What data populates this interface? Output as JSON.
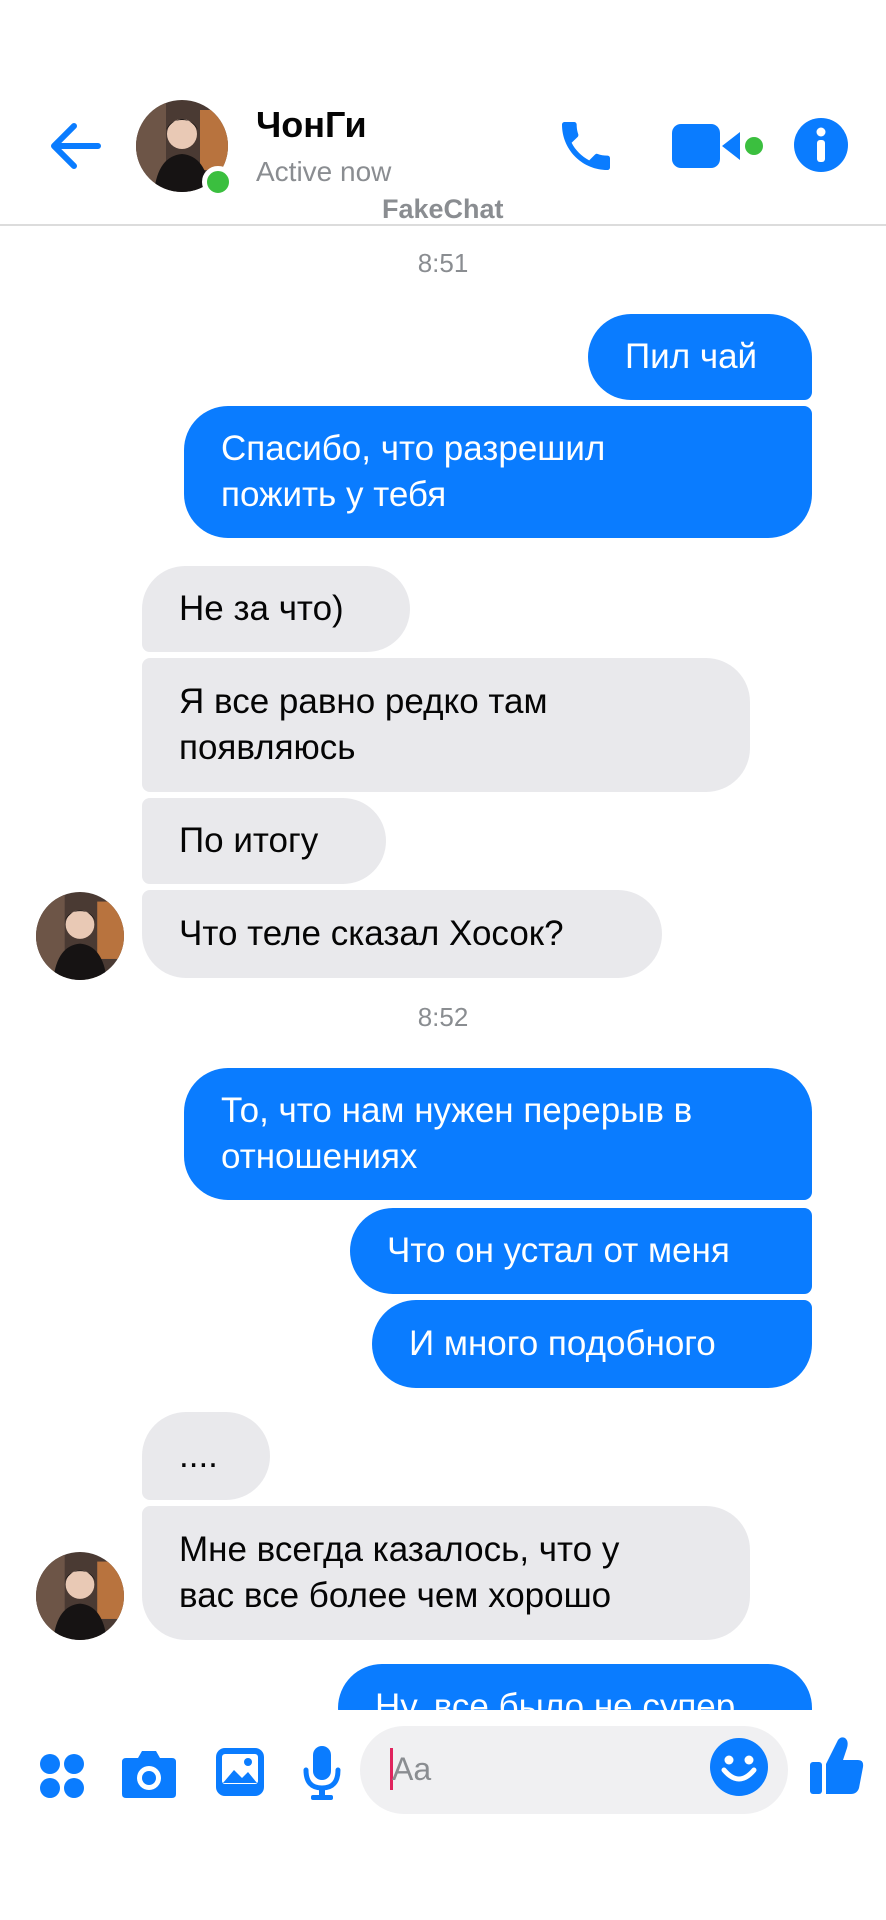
{
  "header": {
    "contact_name": "ЧонГи",
    "status": "Active now",
    "watermark": "FakeChat"
  },
  "messages": {
    "time_1": "8:51",
    "m1": "Пил чай",
    "m2_l1": "Спасибо, что разрешил",
    "m2_l2": "пожить у тебя",
    "m3": "Не за что)",
    "m4_l1": "Я все равно редко там",
    "m4_l2": "появляюсь",
    "m5": "По итогу",
    "m6": "Что теле сказал Хосок?",
    "time_2": "8:52",
    "m7_l1": "То, что нам нужен перерыв в",
    "m7_l2": "отношениях",
    "m8": "Что он устал от меня",
    "m9": "И много подобного",
    "m10": "....",
    "m11_l1": "Мне всегда казалось, что у",
    "m11_l2": "вас все более чем хорошо",
    "m12_partial": "Ну, все было не супер"
  },
  "composer": {
    "placeholder": "Aa"
  },
  "colors": {
    "accent": "#0a7cff",
    "incoming_bubble": "#e9e9ec",
    "online": "#3bbf3f"
  },
  "icons": [
    "back-arrow-icon",
    "phone-icon",
    "video-camera-icon",
    "info-icon",
    "apps-grid-icon",
    "camera-icon",
    "gallery-icon",
    "microphone-icon",
    "emoji-icon",
    "thumbs-up-icon"
  ]
}
